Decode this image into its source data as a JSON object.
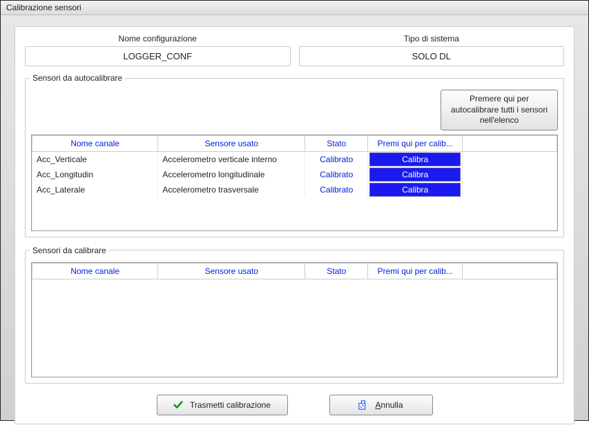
{
  "window": {
    "title": "Calibrazione sensori"
  },
  "config": {
    "name_label": "Nome configurazione",
    "name_value": "LOGGER_CONF",
    "system_label": "Tipo di sistema",
    "system_value": "SOLO DL"
  },
  "autocalib": {
    "legend": "Sensori da autocalibrare",
    "button": "Premere qui per autocalibrare tutti i sensori nell'elenco",
    "headers": {
      "channel": "Nome canale",
      "sensor": "Sensore usato",
      "state": "Stato",
      "action": "Premi qui per calib..."
    },
    "rows": [
      {
        "channel": "Acc_Verticale",
        "sensor": "Accelerometro verticale interno",
        "state": "Calibrato",
        "action": "Calibra"
      },
      {
        "channel": "Acc_Longitudin",
        "sensor": "Accelerometro longitudinale",
        "state": "Calibrato",
        "action": "Calibra"
      },
      {
        "channel": "Acc_Laterale",
        "sensor": "Accelerometro trasversale",
        "state": "Calibrato",
        "action": "Calibra"
      }
    ]
  },
  "calib": {
    "legend": "Sensori da calibrare",
    "headers": {
      "channel": "Nome canale",
      "sensor": "Sensore usato",
      "state": "Stato",
      "action": "Premi qui per calib..."
    }
  },
  "buttons": {
    "transmit": "Trasmetti calibrazione",
    "cancel_pre": "",
    "cancel_underline": "A",
    "cancel_post": "nnulla"
  }
}
